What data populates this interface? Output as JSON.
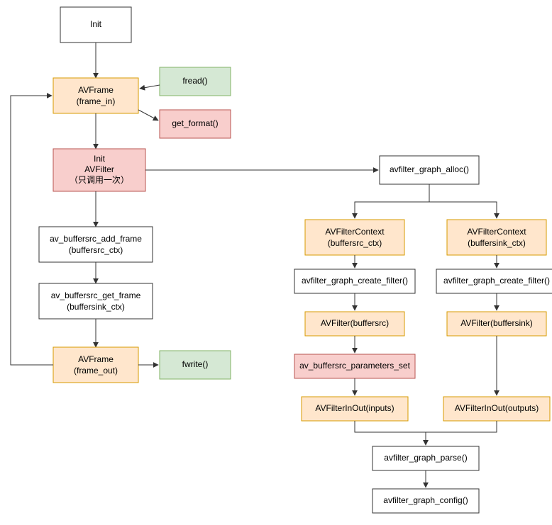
{
  "nodes": {
    "init": {
      "label": "Init"
    },
    "frame_in_1": {
      "label": "AVFrame"
    },
    "frame_in_2": {
      "label": "(frame_in)"
    },
    "fread": {
      "label": "fread()"
    },
    "get_format": {
      "label": "get_format()"
    },
    "init_avf_1": {
      "label": "Init"
    },
    "init_avf_2": {
      "label": "AVFilter"
    },
    "init_avf_3": {
      "label": "（只调用一次）"
    },
    "add_frame_1": {
      "label": "av_buffersrc_add_frame"
    },
    "add_frame_2": {
      "label": "(buffersrc_ctx)"
    },
    "get_frame_1": {
      "label": "av_buffersrc_get_frame"
    },
    "get_frame_2": {
      "label": "(buffersink_ctx)"
    },
    "frame_out_1": {
      "label": "AVFrame"
    },
    "frame_out_2": {
      "label": "(frame_out)"
    },
    "fwrite": {
      "label": "fwrite()"
    },
    "graph_alloc": {
      "label": "avfilter_graph_alloc()"
    },
    "ctx_src_1": {
      "label": "AVFilterContext"
    },
    "ctx_src_2": {
      "label": "(buffersrc_ctx)"
    },
    "ctx_sink_1": {
      "label": "AVFilterContext"
    },
    "ctx_sink_2": {
      "label": "(buffersink_ctx)"
    },
    "create_filter_l": {
      "label": "avfilter_graph_create_filter()"
    },
    "create_filter_r": {
      "label": "avfilter_graph_create_filter()"
    },
    "buf_src": {
      "label": "AVFilter(buffersrc)"
    },
    "buf_sink": {
      "label": "AVFilter(buffersink)"
    },
    "params_set": {
      "label": "av_buffersrc_parameters_set"
    },
    "inout_in": {
      "label": "AVFilterInOut(inputs)"
    },
    "inout_out": {
      "label": "AVFilterInOut(outputs)"
    },
    "graph_parse": {
      "label": "avfilter_graph_parse()"
    },
    "graph_config": {
      "label": "avfilter_graph_config()"
    }
  }
}
